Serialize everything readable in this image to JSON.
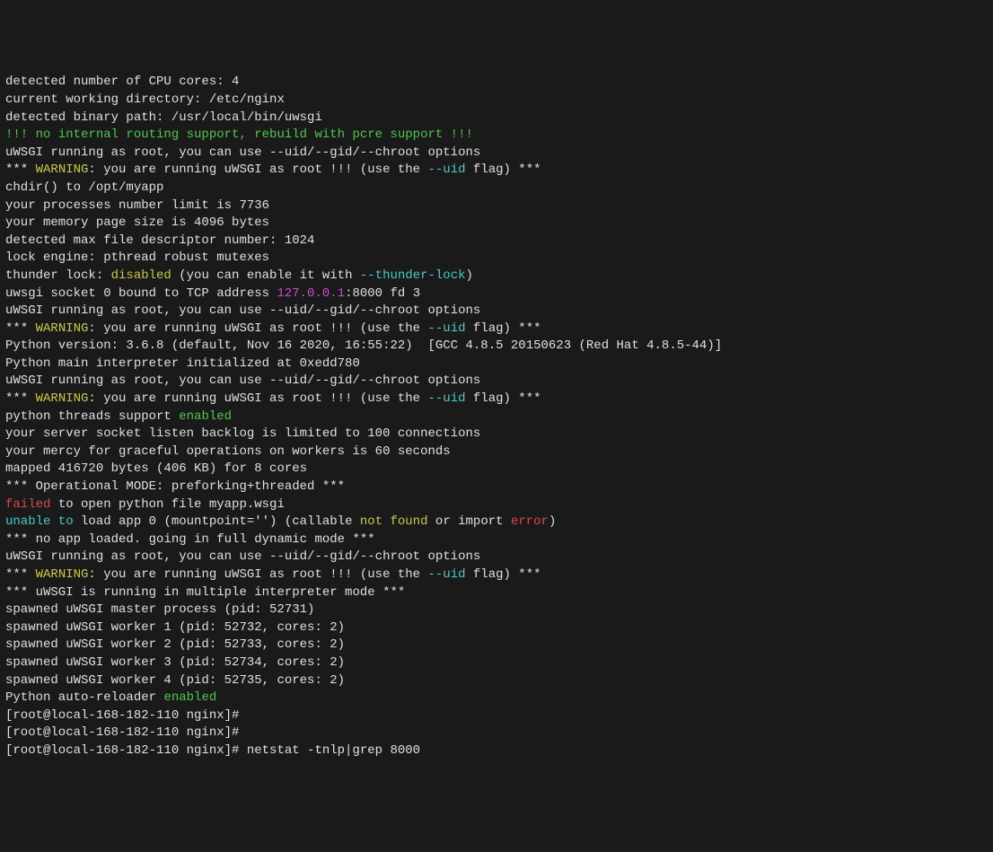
{
  "lines": [
    {
      "segs": [
        {
          "t": "detected number of CPU cores: 4",
          "c": "white"
        }
      ]
    },
    {
      "segs": [
        {
          "t": "current working directory: /etc/nginx",
          "c": "white"
        }
      ]
    },
    {
      "segs": [
        {
          "t": "detected binary path: /usr/local/bin/uwsgi",
          "c": "white"
        }
      ]
    },
    {
      "segs": [
        {
          "t": "!!! no internal routing support, rebuild with pcre support !!!",
          "c": "green"
        }
      ]
    },
    {
      "segs": [
        {
          "t": "uWSGI running as root, you can use --uid/--gid/--chroot options",
          "c": "white"
        }
      ]
    },
    {
      "segs": [
        {
          "t": "*** ",
          "c": "white"
        },
        {
          "t": "WARNING",
          "c": "yellow"
        },
        {
          "t": ": you are running uWSGI as root !!! (use the ",
          "c": "white"
        },
        {
          "t": "--uid",
          "c": "cyan"
        },
        {
          "t": " flag) ***",
          "c": "white"
        }
      ]
    },
    {
      "segs": [
        {
          "t": "chdir() to /opt/myapp",
          "c": "white"
        }
      ]
    },
    {
      "segs": [
        {
          "t": "your processes number limit is 7736",
          "c": "white"
        }
      ]
    },
    {
      "segs": [
        {
          "t": "your memory page size is 4096 bytes",
          "c": "white"
        }
      ]
    },
    {
      "segs": [
        {
          "t": "detected max file descriptor number: 1024",
          "c": "white"
        }
      ]
    },
    {
      "segs": [
        {
          "t": "lock engine: pthread robust mutexes",
          "c": "white"
        }
      ]
    },
    {
      "segs": [
        {
          "t": "thunder lock: ",
          "c": "white"
        },
        {
          "t": "disabled",
          "c": "yellow"
        },
        {
          "t": " (you can enable it with ",
          "c": "white"
        },
        {
          "t": "--thunder-lock",
          "c": "cyan"
        },
        {
          "t": ")",
          "c": "white"
        }
      ]
    },
    {
      "segs": [
        {
          "t": "uwsgi socket 0 bound to TCP address ",
          "c": "white"
        },
        {
          "t": "127.0.0.1",
          "c": "magenta"
        },
        {
          "t": ":8000 fd 3",
          "c": "white"
        }
      ]
    },
    {
      "segs": [
        {
          "t": "uWSGI running as root, you can use --uid/--gid/--chroot options",
          "c": "white"
        }
      ]
    },
    {
      "segs": [
        {
          "t": "*** ",
          "c": "white"
        },
        {
          "t": "WARNING",
          "c": "yellow"
        },
        {
          "t": ": you are running uWSGI as root !!! (use the ",
          "c": "white"
        },
        {
          "t": "--uid",
          "c": "cyan"
        },
        {
          "t": " flag) ***",
          "c": "white"
        }
      ]
    },
    {
      "segs": [
        {
          "t": "Python version: 3.6.8 (default, Nov 16 2020, 16:55:22)  [GCC 4.8.5 20150623 (Red Hat 4.8.5-44)]",
          "c": "white"
        }
      ]
    },
    {
      "segs": [
        {
          "t": "Python main interpreter initialized at 0xedd780",
          "c": "white"
        }
      ]
    },
    {
      "segs": [
        {
          "t": "uWSGI running as root, you can use --uid/--gid/--chroot options",
          "c": "white"
        }
      ]
    },
    {
      "segs": [
        {
          "t": "*** ",
          "c": "white"
        },
        {
          "t": "WARNING",
          "c": "yellow"
        },
        {
          "t": ": you are running uWSGI as root !!! (use the ",
          "c": "white"
        },
        {
          "t": "--uid",
          "c": "cyan"
        },
        {
          "t": " flag) ***",
          "c": "white"
        }
      ]
    },
    {
      "segs": [
        {
          "t": "python threads support ",
          "c": "white"
        },
        {
          "t": "enabled",
          "c": "green"
        }
      ]
    },
    {
      "segs": [
        {
          "t": "your server socket listen backlog is limited to 100 connections",
          "c": "white"
        }
      ]
    },
    {
      "segs": [
        {
          "t": "your mercy for graceful operations on workers is 60 seconds",
          "c": "white"
        }
      ]
    },
    {
      "segs": [
        {
          "t": "mapped 416720 bytes (406 KB) for 8 cores",
          "c": "white"
        }
      ]
    },
    {
      "segs": [
        {
          "t": "*** Operational MODE: preforking+threaded ***",
          "c": "white"
        }
      ]
    },
    {
      "segs": [
        {
          "t": "failed",
          "c": "red"
        },
        {
          "t": " to open python file myapp.wsgi",
          "c": "white"
        }
      ]
    },
    {
      "segs": [
        {
          "t": "unable to",
          "c": "cyan"
        },
        {
          "t": " load app 0 (mountpoint='') (callable ",
          "c": "white"
        },
        {
          "t": "not found",
          "c": "yellow"
        },
        {
          "t": " or import ",
          "c": "white"
        },
        {
          "t": "error",
          "c": "red"
        },
        {
          "t": ")",
          "c": "white"
        }
      ]
    },
    {
      "segs": [
        {
          "t": "*** no app loaded. going in full dynamic mode ***",
          "c": "white"
        }
      ]
    },
    {
      "segs": [
        {
          "t": "uWSGI running as root, you can use --uid/--gid/--chroot options",
          "c": "white"
        }
      ]
    },
    {
      "segs": [
        {
          "t": "*** ",
          "c": "white"
        },
        {
          "t": "WARNING",
          "c": "yellow"
        },
        {
          "t": ": you are running uWSGI as root !!! (use the ",
          "c": "white"
        },
        {
          "t": "--uid",
          "c": "cyan"
        },
        {
          "t": " flag) ***",
          "c": "white"
        }
      ]
    },
    {
      "segs": [
        {
          "t": "*** uWSGI is running in multiple interpreter mode ***",
          "c": "white"
        }
      ]
    },
    {
      "segs": [
        {
          "t": "spawned uWSGI master process (pid: 52731)",
          "c": "white"
        }
      ]
    },
    {
      "segs": [
        {
          "t": "spawned uWSGI worker 1 (pid: 52732, cores: 2)",
          "c": "white"
        }
      ]
    },
    {
      "segs": [
        {
          "t": "spawned uWSGI worker 2 (pid: 52733, cores: 2)",
          "c": "white"
        }
      ]
    },
    {
      "segs": [
        {
          "t": "spawned uWSGI worker 3 (pid: 52734, cores: 2)",
          "c": "white"
        }
      ]
    },
    {
      "segs": [
        {
          "t": "spawned uWSGI worker 4 (pid: 52735, cores: 2)",
          "c": "white"
        }
      ]
    },
    {
      "segs": [
        {
          "t": "Python auto-reloader ",
          "c": "white"
        },
        {
          "t": "enabled",
          "c": "green"
        }
      ]
    },
    {
      "segs": [
        {
          "t": "[root@local-168-182-110 nginx]#",
          "c": "white"
        }
      ]
    },
    {
      "segs": [
        {
          "t": "[root@local-168-182-110 nginx]#",
          "c": "white"
        }
      ]
    },
    {
      "segs": [
        {
          "t": "[root@local-168-182-110 nginx]# netstat -tnlp|grep 8000",
          "c": "white"
        }
      ]
    }
  ]
}
